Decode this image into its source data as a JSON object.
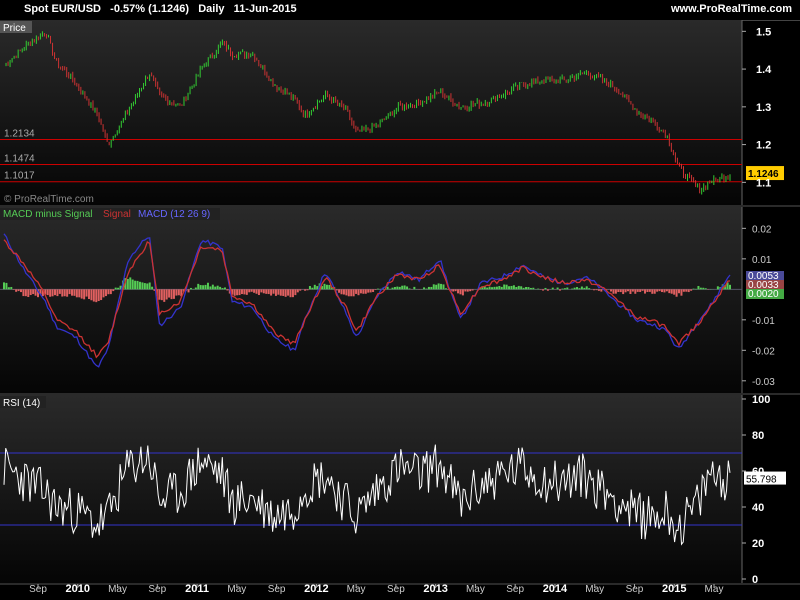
{
  "header": {
    "title": "Spot EUR/USD   -0.57% (1.1246)   Daily   11-Jun-2015",
    "site": "www.ProRealTime.com"
  },
  "colors": {
    "background": "#000000",
    "panel_bg_top": "#2a2a2a",
    "panel_bg_bottom": "#050505",
    "up_bar": "#33cc33",
    "down_bar": "#cc3333",
    "support_line": "#cc0000",
    "macd_line": "#3333cc",
    "signal_line": "#cc3333",
    "hist_pos": "#55cc55",
    "hist_neg": "#e06060",
    "rsi_line": "#ffffff",
    "rsi_band": "#3333cc",
    "price_badge": "#ffcc00"
  },
  "chart_data": [
    {
      "panel": "price",
      "type": "ohlc",
      "title": "Price",
      "watermark": "© ProRealTime.com",
      "ylim": [
        1.04,
        1.53
      ],
      "yticks": [
        1.1,
        1.2,
        1.3,
        1.4,
        1.5
      ],
      "ytick_labels": [
        "1.1",
        "1.2",
        "1.3",
        "1.4",
        "1.5"
      ],
      "hlines": [
        {
          "value": 1.2134,
          "label": "1.2134"
        },
        {
          "value": 1.1474,
          "label": "1.1474"
        },
        {
          "value": 1.1017,
          "label": "1.1017"
        }
      ],
      "last": {
        "value": 1.1246,
        "label": "1.1246"
      },
      "x": [
        "2009-08",
        "2009-10",
        "2009-12",
        "2010-01",
        "2010-03",
        "2010-05",
        "2010-06",
        "2010-08",
        "2010-10",
        "2010-11",
        "2011-01",
        "2011-03",
        "2011-05",
        "2011-06",
        "2011-08",
        "2011-10",
        "2011-12",
        "2012-01",
        "2012-03",
        "2012-05",
        "2012-06",
        "2012-08",
        "2012-10",
        "2012-12",
        "2013-02",
        "2013-04",
        "2013-06",
        "2013-08",
        "2013-10",
        "2013-12",
        "2014-02",
        "2014-04",
        "2014-05",
        "2014-07",
        "2014-09",
        "2014-11",
        "2014-12",
        "2015-01",
        "2015-03",
        "2015-04",
        "2015-06"
      ],
      "values": [
        1.41,
        1.46,
        1.5,
        1.42,
        1.36,
        1.28,
        1.2,
        1.29,
        1.39,
        1.33,
        1.3,
        1.4,
        1.47,
        1.44,
        1.44,
        1.36,
        1.32,
        1.28,
        1.33,
        1.29,
        1.23,
        1.25,
        1.3,
        1.31,
        1.34,
        1.3,
        1.31,
        1.33,
        1.36,
        1.37,
        1.37,
        1.39,
        1.38,
        1.35,
        1.29,
        1.25,
        1.22,
        1.14,
        1.08,
        1.1,
        1.12
      ]
    },
    {
      "panel": "macd",
      "type": "line",
      "legend": {
        "histogram": "MACD minus Signal",
        "signal": "Signal",
        "macd": "MACD (12 26 9)"
      },
      "ylim": [
        -0.034,
        0.027
      ],
      "yticks": [
        0.02,
        0.01,
        -0.01,
        -0.02,
        -0.03
      ],
      "ytick_labels": [
        "0.02",
        "0.01",
        "-0.01",
        "-0.02",
        "-0.03"
      ],
      "last_labels": [
        "0.0053",
        "0.0033",
        "0.0020"
      ],
      "x": [
        "2009-08",
        "2009-10",
        "2009-12",
        "2010-01",
        "2010-03",
        "2010-05",
        "2010-06",
        "2010-08",
        "2010-10",
        "2010-11",
        "2011-01",
        "2011-03",
        "2011-05",
        "2011-06",
        "2011-08",
        "2011-10",
        "2011-12",
        "2012-01",
        "2012-03",
        "2012-05",
        "2012-06",
        "2012-08",
        "2012-10",
        "2012-12",
        "2013-02",
        "2013-04",
        "2013-06",
        "2013-08",
        "2013-10",
        "2013-12",
        "2014-02",
        "2014-04",
        "2014-05",
        "2014-07",
        "2014-09",
        "2014-11",
        "2014-12",
        "2015-01",
        "2015-03",
        "2015-04",
        "2015-06"
      ],
      "series": [
        {
          "name": "MACD (12 26 9)",
          "values": [
            0.018,
            0.006,
            -0.004,
            -0.012,
            -0.016,
            -0.026,
            -0.02,
            0.01,
            0.018,
            -0.012,
            -0.006,
            0.016,
            0.014,
            -0.004,
            -0.006,
            -0.016,
            -0.02,
            -0.01,
            0.006,
            -0.008,
            -0.016,
            -0.002,
            0.006,
            0.003,
            0.01,
            -0.01,
            0.002,
            0.004,
            0.008,
            0.004,
            0.002,
            0.004,
            0.002,
            -0.004,
            -0.01,
            -0.012,
            -0.014,
            -0.02,
            -0.01,
            -0.006,
            0.005
          ]
        },
        {
          "name": "Signal",
          "values": [
            0.016,
            0.008,
            -0.002,
            -0.01,
            -0.014,
            -0.022,
            -0.018,
            0.006,
            0.016,
            -0.008,
            -0.004,
            0.014,
            0.013,
            -0.002,
            -0.005,
            -0.014,
            -0.018,
            -0.01,
            0.004,
            -0.006,
            -0.014,
            -0.002,
            0.005,
            0.003,
            0.008,
            -0.008,
            0.001,
            0.003,
            0.007,
            0.004,
            0.002,
            0.003,
            0.002,
            -0.003,
            -0.009,
            -0.011,
            -0.013,
            -0.018,
            -0.011,
            -0.006,
            0.003
          ]
        },
        {
          "name": "MACD minus Signal",
          "values": [
            0.002,
            -0.002,
            -0.002,
            -0.002,
            -0.002,
            -0.004,
            -0.002,
            0.004,
            0.002,
            -0.004,
            -0.002,
            0.002,
            0.001,
            -0.002,
            -0.001,
            -0.002,
            -0.002,
            0.0,
            0.002,
            -0.002,
            -0.002,
            0.0,
            0.001,
            0.0,
            0.002,
            -0.002,
            0.001,
            0.001,
            0.001,
            0.0,
            0.0,
            0.001,
            0.0,
            -0.001,
            -0.001,
            -0.001,
            -0.001,
            -0.002,
            0.001,
            0.0,
            0.002
          ]
        }
      ]
    },
    {
      "panel": "rsi",
      "type": "line",
      "title": "RSI (14)",
      "ylim": [
        0,
        100
      ],
      "yticks": [
        0,
        20,
        40,
        60,
        80,
        100
      ],
      "ytick_labels": [
        "0",
        "20",
        "40",
        "60",
        "80",
        "100"
      ],
      "bands": [
        30,
        70
      ],
      "last": {
        "value": 55.798,
        "label": "55.798"
      },
      "x": [
        "2009-08",
        "2009-10",
        "2009-12",
        "2010-01",
        "2010-03",
        "2010-05",
        "2010-06",
        "2010-08",
        "2010-10",
        "2010-11",
        "2011-01",
        "2011-03",
        "2011-05",
        "2011-06",
        "2011-08",
        "2011-10",
        "2011-12",
        "2012-01",
        "2012-03",
        "2012-05",
        "2012-06",
        "2012-08",
        "2012-10",
        "2012-12",
        "2013-02",
        "2013-04",
        "2013-06",
        "2013-08",
        "2013-10",
        "2013-12",
        "2014-02",
        "2014-04",
        "2014-05",
        "2014-07",
        "2014-09",
        "2014-11",
        "2014-12",
        "2015-01",
        "2015-03",
        "2015-04",
        "2015-06"
      ],
      "values": [
        62,
        55,
        48,
        40,
        38,
        30,
        35,
        62,
        68,
        44,
        48,
        66,
        58,
        42,
        45,
        35,
        40,
        52,
        58,
        42,
        35,
        50,
        62,
        58,
        64,
        42,
        52,
        58,
        62,
        55,
        54,
        58,
        52,
        45,
        35,
        35,
        38,
        28,
        42,
        58,
        56
      ]
    }
  ],
  "x_axis": {
    "labels": [
      {
        "text": "Sep",
        "year": false
      },
      {
        "text": "2010",
        "year": true
      },
      {
        "text": "May",
        "year": false
      },
      {
        "text": "Sep",
        "year": false
      },
      {
        "text": "2011",
        "year": true
      },
      {
        "text": "May",
        "year": false
      },
      {
        "text": "Sep",
        "year": false
      },
      {
        "text": "2012",
        "year": true
      },
      {
        "text": "May",
        "year": false
      },
      {
        "text": "Sep",
        "year": false
      },
      {
        "text": "2013",
        "year": true
      },
      {
        "text": "May",
        "year": false
      },
      {
        "text": "Sep",
        "year": false
      },
      {
        "text": "2014",
        "year": true
      },
      {
        "text": "May",
        "year": false
      },
      {
        "text": "Sep",
        "year": false
      },
      {
        "text": "2015",
        "year": true
      },
      {
        "text": "May",
        "year": false
      }
    ]
  }
}
